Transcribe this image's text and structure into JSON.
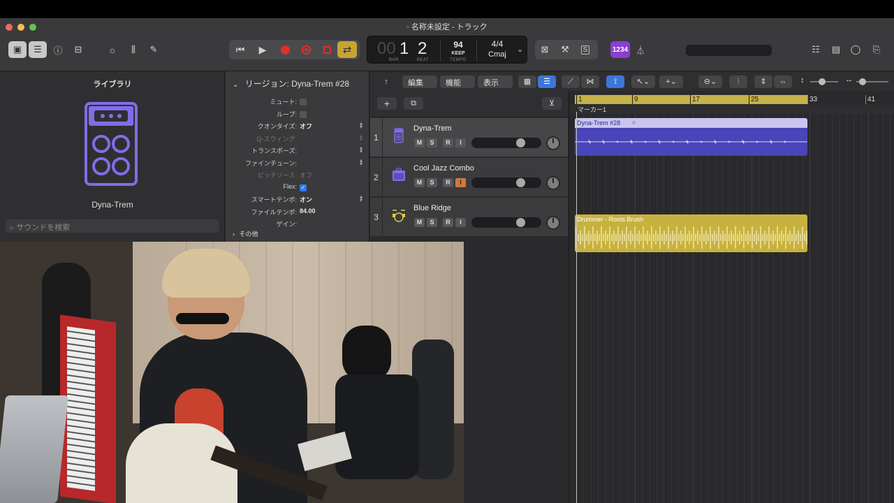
{
  "window": {
    "title": "名称未設定 - トラック"
  },
  "lcd": {
    "bar": "1",
    "bar_dim": "00",
    "beat": "2",
    "bar_label": "BAR",
    "beat_label": "BEAT",
    "tempo": "94",
    "tempo_mode": "KEEP",
    "tempo_label": "TEMPO",
    "time_signature": "4/4",
    "key": "Cmaj"
  },
  "count_in": "1234",
  "library": {
    "title": "ライブラリ",
    "patch_name": "Dyna-Trem",
    "search_placeholder": "サウンドを検索"
  },
  "inspector": {
    "region_header": "リージョン: Dyna-Trem #28",
    "rows": [
      {
        "key": "ミュート:",
        "type": "checkbox",
        "checked": false
      },
      {
        "key": "ループ:",
        "type": "checkbox",
        "checked": false
      },
      {
        "key": "クオンタイズ:",
        "value": "オフ"
      },
      {
        "key": "Q-スウィング:",
        "value": "",
        "disabled": true
      },
      {
        "key": "トランスポーズ:",
        "value": ""
      },
      {
        "key": "ファインチューン:",
        "value": ""
      },
      {
        "key": "ピッチソース:",
        "value": "オフ",
        "disabled": true
      },
      {
        "key": "Flex:",
        "type": "checkbox",
        "checked": true
      },
      {
        "key": "スマートテンポ:",
        "value": "オン"
      },
      {
        "key": "ファイルテンポ:",
        "value": "84.00"
      },
      {
        "key": "ゲイン:",
        "value": ""
      }
    ],
    "more": "その他"
  },
  "track_toolbar": {
    "edit": "編集",
    "function": "機能",
    "view": "表示"
  },
  "tracks": [
    {
      "number": "1",
      "name": "Dyna-Trem",
      "selected": true,
      "record_enabled": false
    },
    {
      "number": "2",
      "name": "Cool Jazz Combo",
      "selected": false,
      "record_enabled": true
    },
    {
      "number": "3",
      "name": "Blue Ridge",
      "selected": false,
      "record_enabled": false
    }
  ],
  "track_buttons": {
    "mute": "M",
    "solo": "S",
    "record": "R",
    "input": "I"
  },
  "ruler": {
    "bars": [
      "1",
      "9",
      "17",
      "25",
      "33",
      "41"
    ],
    "marker": "マーカー1"
  },
  "regions": [
    {
      "name": "Dyna-Trem #28",
      "track": 1,
      "color": "#4a45b8",
      "header_color": "#c9c5f0"
    },
    {
      "name": "Drummer - Roots Brush",
      "track": 3,
      "color": "#c8b23e",
      "header_color": "#c8b23e"
    }
  ],
  "colors": {
    "accent_blue": "#3c77d8",
    "cycle_yellow": "#c6b24a",
    "count_in_purple": "#8a3fd1",
    "record_red": "#e0302a"
  }
}
